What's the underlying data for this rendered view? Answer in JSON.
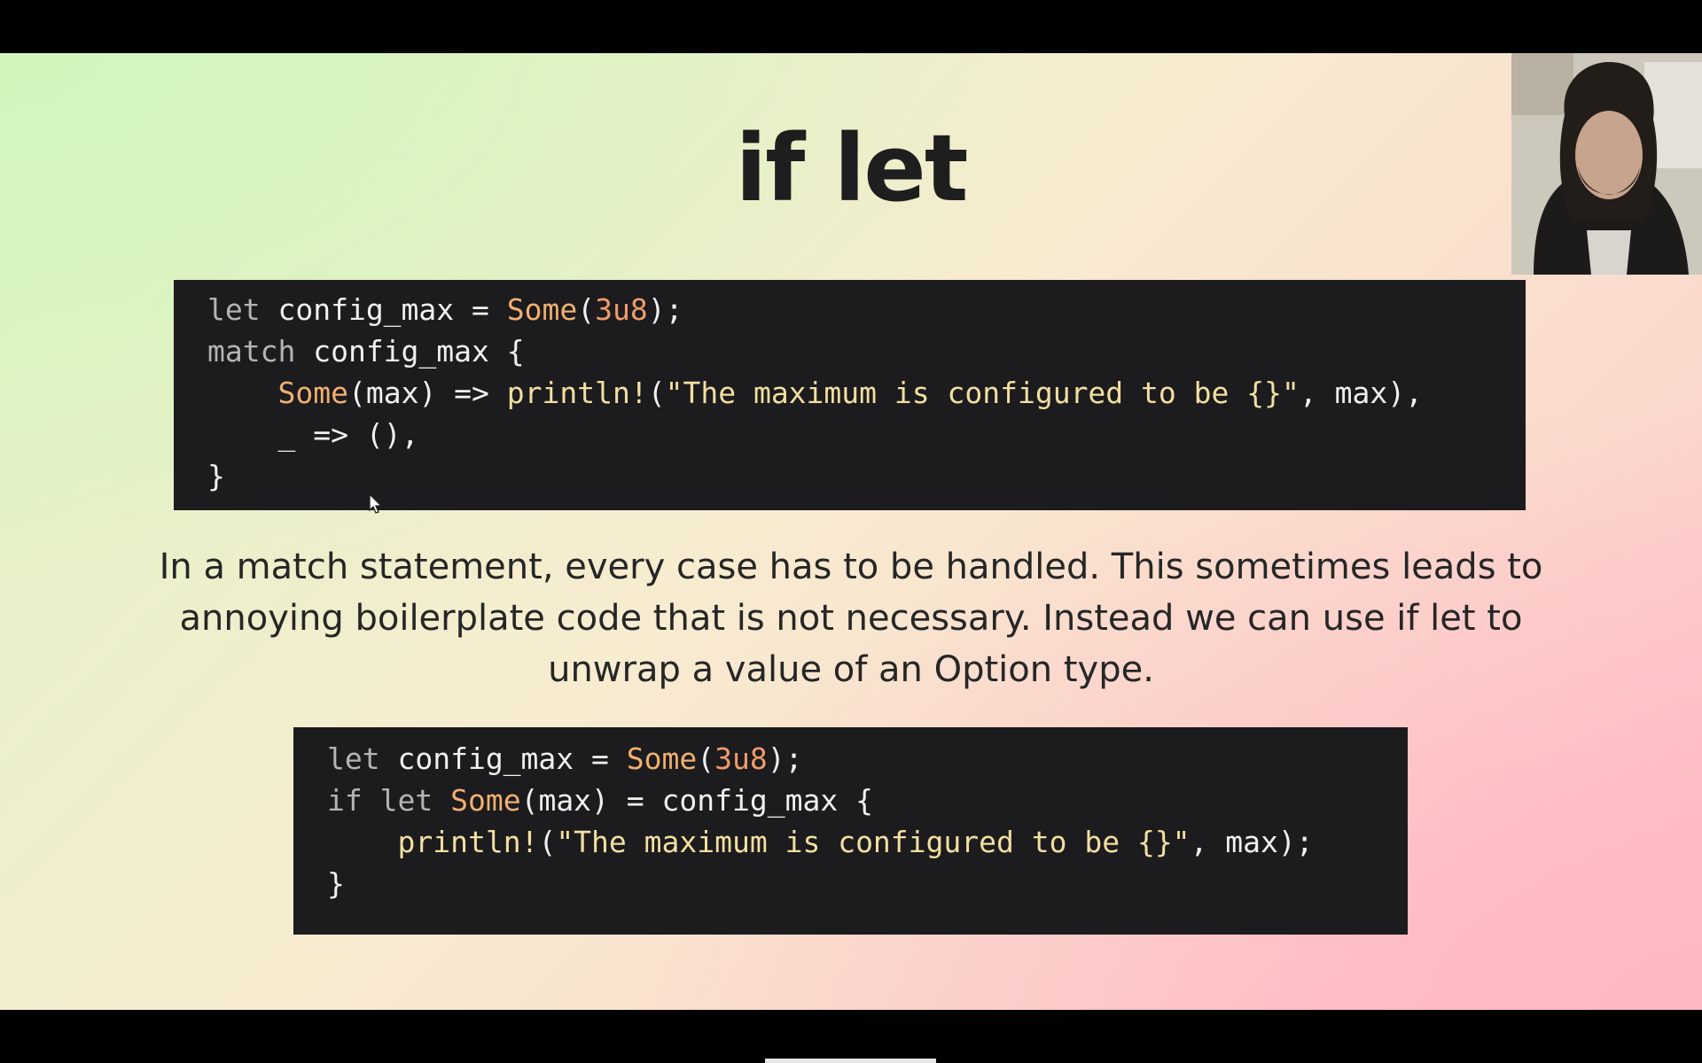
{
  "slide": {
    "title": "if let",
    "description": "In a match statement, every case has to be handled. This sometimes leads to annoying boilerplate code that is not necessary. Instead we can use if let to unwrap a value of an Option type.",
    "code_match": {
      "l1": {
        "kw": "let",
        "a": " config_max = ",
        "ty": "Some",
        "b": "(",
        "num": "3u8",
        "c": ");"
      },
      "l2": {
        "kw": "match",
        "a": " config_max {"
      },
      "l3": {
        "indent": "    ",
        "ty": "Some",
        "a": "(max) => ",
        "mac": "println!",
        "b": "(",
        "str": "\"The maximum is configured to be {}\"",
        "c": ", max),"
      },
      "l4": {
        "indent": "    ",
        "a": "_ => ",
        "b": "(),"
      },
      "l5": {
        "a": "}"
      }
    },
    "code_iflet": {
      "l1": {
        "kw": "let",
        "a": " config_max = ",
        "ty": "Some",
        "b": "(",
        "num": "3u8",
        "c": ");"
      },
      "l2": {
        "kw": "if let",
        "a": " ",
        "ty": "Some",
        "b": "(max) = config_max {"
      },
      "l3": {
        "indent": "    ",
        "mac": "println!",
        "b": "(",
        "str": "\"The maximum is configured to be {}\"",
        "c": ", max);"
      },
      "l4": {
        "a": "}"
      }
    }
  },
  "webcam": {
    "icon": "person-webcam-icon"
  },
  "cursor": {
    "icon": "mouse-pointer-icon"
  }
}
